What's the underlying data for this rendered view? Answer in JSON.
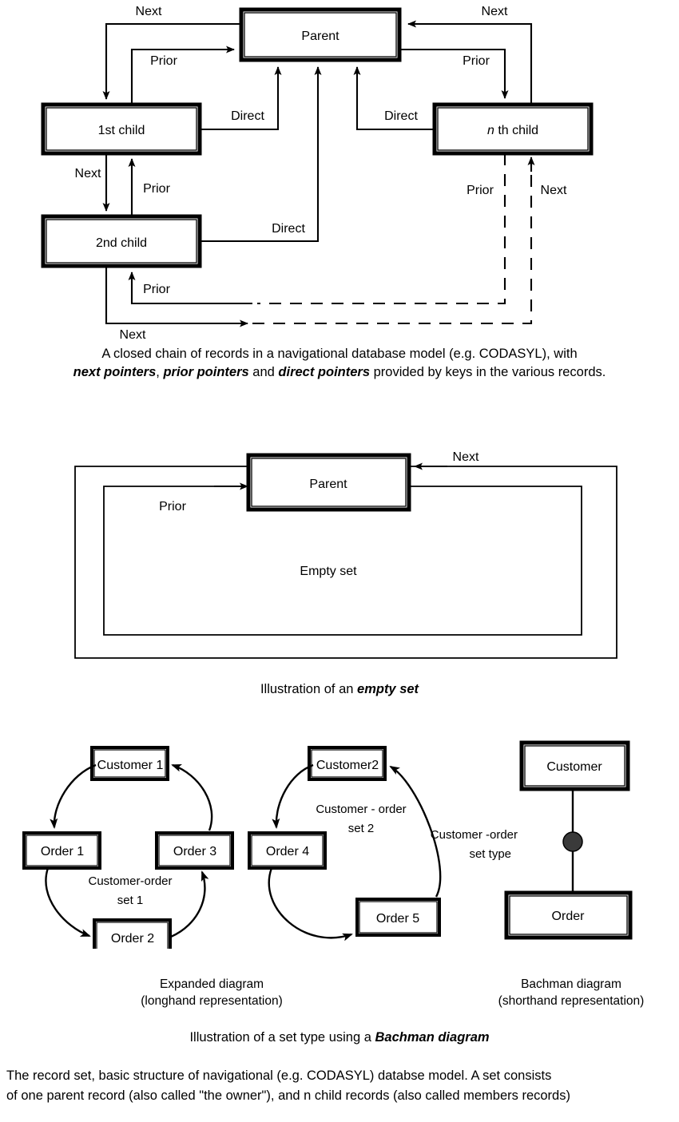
{
  "figure1": {
    "title": "closed-chain-of-records",
    "boxes": [
      {
        "id": "parent",
        "label": "Parent"
      },
      {
        "id": "first-child",
        "label": "1st child"
      },
      {
        "id": "second-child",
        "label": "2nd child"
      },
      {
        "id": "nth-child",
        "label_italic": "n",
        "label_rest": " th child"
      }
    ],
    "edge_labels": {
      "next_top_left": "Next",
      "next_top_right": "Next",
      "prior_top_left": "Prior",
      "prior_top_right": "Prior",
      "direct_left": "Direct",
      "direct_right": "Direct",
      "direct_bottom": "Direct",
      "next_left_mid": "Next",
      "prior_left_mid": "Prior",
      "prior_bottom_left": "Prior",
      "next_bottom_left": "Next",
      "prior_right_bottom": "Prior",
      "next_right_bottom": "Next"
    }
  },
  "caption1": {
    "line1": "A closed chain of records in a navigational database model (e.g. CODASYL), with",
    "line2_a": "next pointers",
    "line2_b": ", ",
    "line2_c": "prior pointers",
    "line2_d": " and ",
    "line2_e": "direct pointers",
    "line2_f": " provided by keys in the various records."
  },
  "figure2": {
    "title": "empty-set-diagram",
    "parent_label": "Parent",
    "empty_set_label": "Empty set",
    "next_label": "Next",
    "prior_label": "Prior"
  },
  "caption2": {
    "prefix": "Illustration of an ",
    "emphasis": "empty set"
  },
  "figure3": {
    "title": "set-type-bachman",
    "expanded_set1": {
      "nodes": [
        {
          "id": "customer-1",
          "label": "Customer 1"
        },
        {
          "id": "order-1",
          "label": "Order 1"
        },
        {
          "id": "order-2",
          "label": "Order 2"
        },
        {
          "id": "order-3",
          "label": "Order 3"
        }
      ],
      "set_label_line1": "Customer-order",
      "set_label_line2": "set 1"
    },
    "expanded_set2": {
      "nodes": [
        {
          "id": "customer-2",
          "label": "Customer2"
        },
        {
          "id": "order-4",
          "label": "Order 4"
        },
        {
          "id": "order-5",
          "label": "Order 5"
        }
      ],
      "set_label_line1": "Customer - order",
      "set_label_line2": "set 2"
    },
    "bachman": {
      "owner_label": "Customer",
      "member_label": "Order",
      "set_type_line1": "Customer -order",
      "set_type_line2": "set type"
    },
    "sub_captions": {
      "left_line1": "Expanded diagram",
      "left_line2": "(longhand representation)",
      "right_line1": "Bachman diagram",
      "right_line2": "(shorthand representation)"
    }
  },
  "caption3": {
    "prefix": "Illustration of a set type using a ",
    "emphasis": "Bachman diagram"
  },
  "body_text": {
    "line1": "The record set, basic structure of navigational (e.g. CODASYL) databse model. A set consists",
    "line2": "of one parent record (also called \"the owner\"), and n child records (also called members records)"
  },
  "colors": {
    "ink": "#000000",
    "paper": "#ffffff"
  }
}
